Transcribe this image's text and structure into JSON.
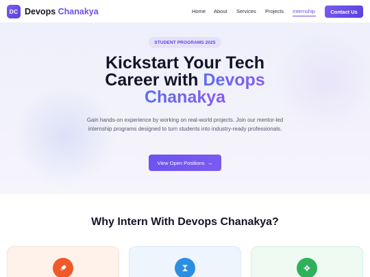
{
  "brand": {
    "badge": "DC",
    "name_part1": "Devops",
    "name_part2": "Chanakya"
  },
  "nav": {
    "items": [
      {
        "label": "Home"
      },
      {
        "label": "About"
      },
      {
        "label": "Services"
      },
      {
        "label": "Projects"
      },
      {
        "label": "Internship",
        "active": true
      }
    ],
    "contact_label": "Contact Us"
  },
  "hero": {
    "pill": "STUDENT PROGRAMS 2025",
    "headline_line1": "Kickstart Your Tech",
    "headline_line2_plain": "Career with ",
    "headline_line2_accent": "Devops",
    "headline_line3_accent": "Chanakya",
    "subtitle": "Gain hands-on experience by working on real-world projects. Join our mentor-led internship programs designed to turn students into industry-ready professionals.",
    "cta_label": "View Open Positions",
    "cta_icon": "arrow-right-icon"
  },
  "section": {
    "title": "Why Intern With Devops Chanakya?",
    "cards": [
      {
        "icon": "rocket-icon",
        "color": "#f05a28"
      },
      {
        "icon": "hourglass-icon",
        "color": "#2c8ee0"
      },
      {
        "icon": "gear-icon",
        "color": "#2fb05a"
      }
    ]
  },
  "colors": {
    "accent": "#6d4ee8",
    "text": "#141428"
  }
}
